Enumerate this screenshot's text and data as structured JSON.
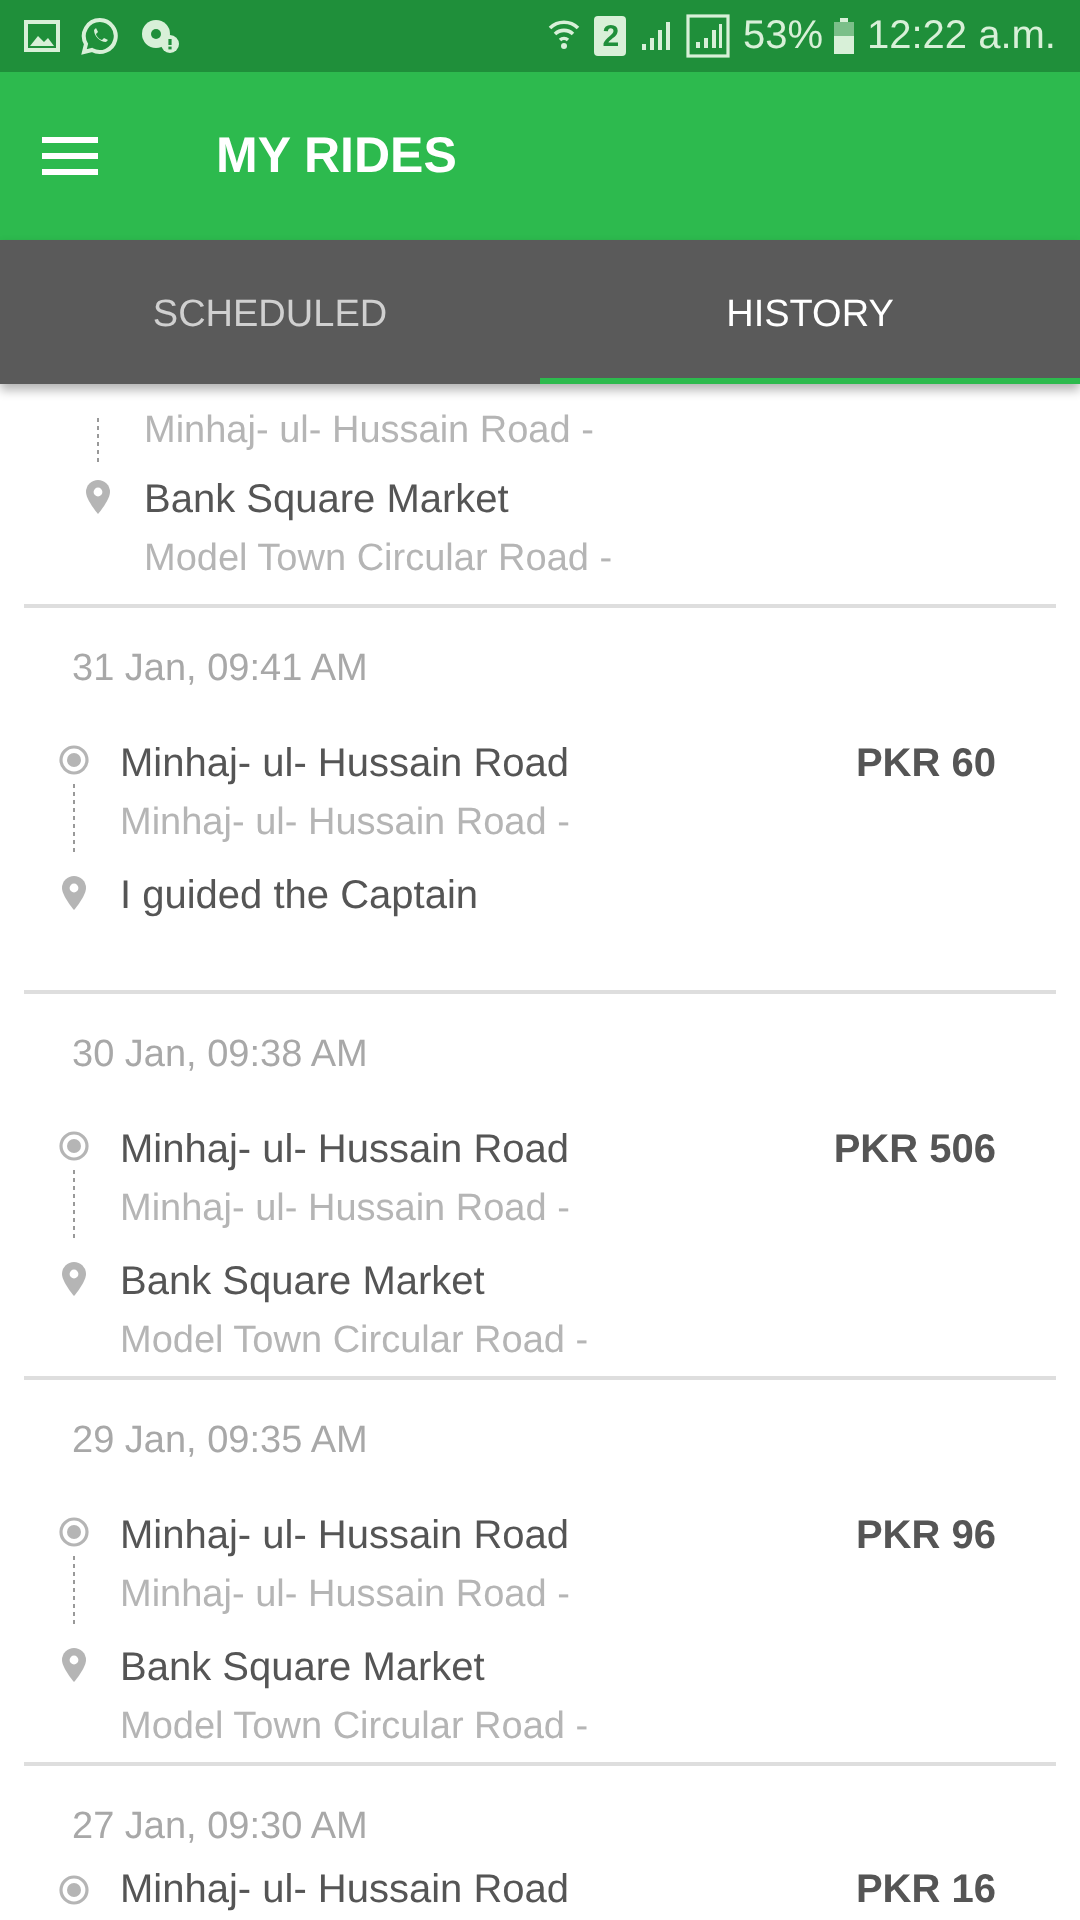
{
  "status_bar": {
    "sim_label": "2",
    "battery": "53%",
    "time": "12:22 a.m."
  },
  "app_bar": {
    "title": "MY RIDES"
  },
  "tabs": [
    {
      "label": "SCHEDULED",
      "selected": false
    },
    {
      "label": "HISTORY",
      "selected": true
    }
  ],
  "rides": [
    {
      "pickup": {
        "address": "Minhaj- ul- Hussain Road -"
      },
      "dropoff": {
        "name": "Bank Square Market",
        "address": "Model Town Circular Road -"
      }
    },
    {
      "date": "31 Jan, 09:41 AM",
      "fare": "PKR 60",
      "pickup": {
        "name": "Minhaj- ul- Hussain Road",
        "address": "Minhaj- ul- Hussain Road -"
      },
      "dropoff": {
        "name": "I guided the Captain"
      }
    },
    {
      "date": "30 Jan, 09:38 AM",
      "fare": "PKR 506",
      "pickup": {
        "name": "Minhaj- ul- Hussain Road",
        "address": "Minhaj- ul- Hussain Road -"
      },
      "dropoff": {
        "name": "Bank Square Market",
        "address": "Model Town Circular Road -"
      }
    },
    {
      "date": "29 Jan, 09:35 AM",
      "fare": "PKR 96",
      "pickup": {
        "name": "Minhaj- ul- Hussain Road",
        "address": "Minhaj- ul- Hussain Road -"
      },
      "dropoff": {
        "name": "Bank Square Market",
        "address": "Model Town Circular Road -"
      }
    },
    {
      "date": "27 Jan, 09:30 AM",
      "fare": "PKR 16",
      "pickup": {
        "name": "Minhaj- ul- Hussain Road"
      }
    }
  ]
}
